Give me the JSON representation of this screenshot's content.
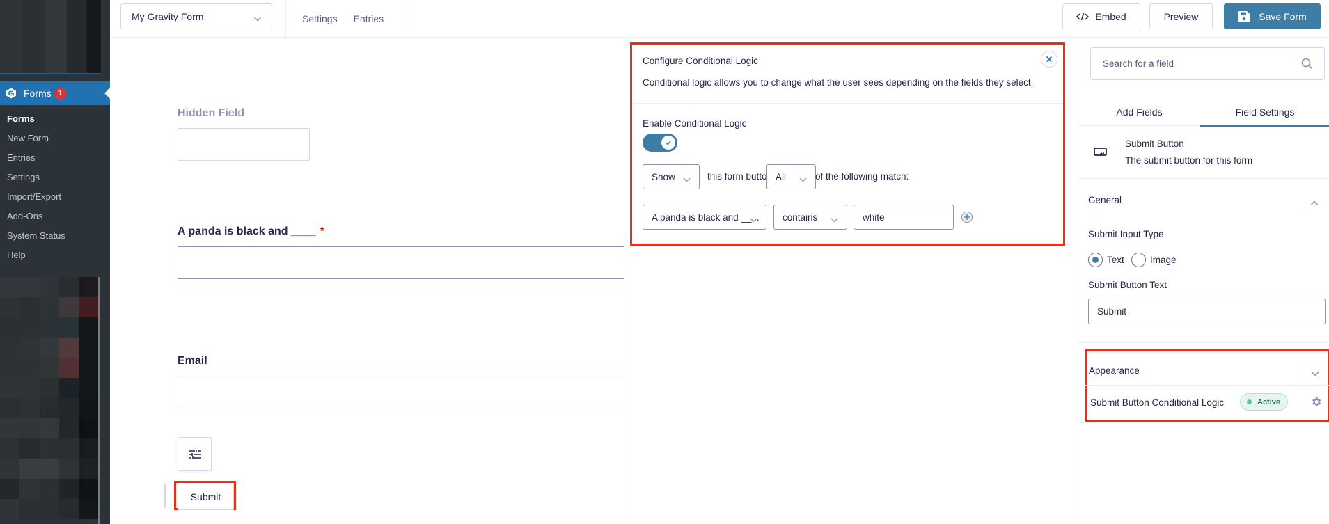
{
  "wp_sidebar": {
    "menu_label": "Forms",
    "menu_count": "1",
    "submenu": [
      {
        "label": "Forms",
        "current": true
      },
      {
        "label": "New Form"
      },
      {
        "label": "Entries"
      },
      {
        "label": "Settings"
      },
      {
        "label": "Import/Export"
      },
      {
        "label": "Add-Ons"
      },
      {
        "label": "System Status"
      },
      {
        "label": "Help"
      }
    ]
  },
  "header": {
    "form_selector": "My Gravity Form",
    "nav": [
      "Settings",
      "Entries"
    ],
    "buttons": {
      "embed": "Embed",
      "preview": "Preview",
      "save": "Save Form"
    }
  },
  "form": {
    "fields": [
      {
        "label": "Hidden Field",
        "required": false,
        "type": "hidden"
      },
      {
        "label": "A panda is black and ____",
        "required": true,
        "required_mark": "*"
      },
      {
        "label": "Email",
        "required": false
      }
    ],
    "submit_label": "Submit"
  },
  "conditional_logic": {
    "title": "Configure Conditional Logic",
    "description": "Conditional logic allows you to change what the user sees depending on the fields they select.",
    "enable_label": "Enable Conditional Logic",
    "enabled": true,
    "action": "Show",
    "text_mid": "this form button if",
    "logic_type": "All",
    "text_end": "of the following match:",
    "rules": [
      {
        "field": "A panda is black and __...",
        "operator": "contains",
        "value": "white"
      }
    ]
  },
  "settings_panel": {
    "search_placeholder": "Search for a field",
    "tabs": [
      {
        "label": "Add Fields",
        "active": false
      },
      {
        "label": "Field Settings",
        "active": true
      }
    ],
    "field": {
      "name": "Submit Button",
      "description": "The submit button for this form"
    },
    "general": {
      "title": "General",
      "input_type_label": "Submit Input Type",
      "input_type_options": [
        {
          "label": "Text",
          "selected": true
        },
        {
          "label": "Image",
          "selected": false
        }
      ],
      "button_text_label": "Submit Button Text",
      "button_text_value": "Submit"
    },
    "appearance": {
      "title": "Appearance",
      "logic_label": "Submit Button Conditional Logic",
      "status": "Active"
    }
  },
  "colors": {
    "accent": "#3e7da6",
    "wp_highlight": "#2271b1",
    "annotation_red": "#ea2f14",
    "active_badge_bg": "#e4f6ed",
    "required": "#c02b0a"
  }
}
